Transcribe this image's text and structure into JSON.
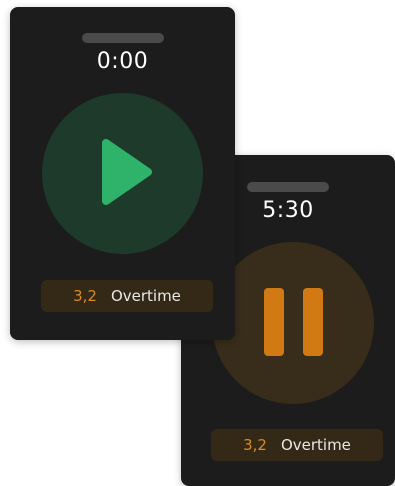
{
  "timers": [
    {
      "id": "stopped",
      "time": "0:00",
      "state": "stopped",
      "action_icon": "play-icon",
      "overtime_count": "3,2",
      "overtime_label": "Overtime",
      "accent_color": "#2fb36a"
    },
    {
      "id": "running",
      "time": "5:30",
      "state": "running",
      "action_icon": "pause-icon",
      "overtime_count": "3,2",
      "overtime_label": "Overtime",
      "accent_color": "#d17a14"
    }
  ]
}
